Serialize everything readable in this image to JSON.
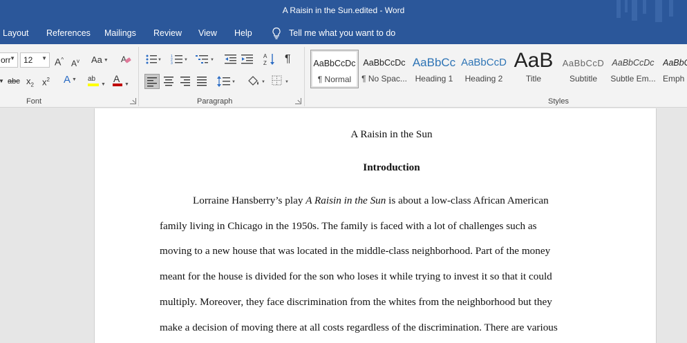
{
  "window": {
    "title": "A Raisin in the Sun.edited  -  Word"
  },
  "tabs": [
    "Layout",
    "References",
    "Mailings",
    "Review",
    "View",
    "Help"
  ],
  "tell_me": "Tell me what you want to do",
  "font_group": {
    "font_name": "orr",
    "font_size": "12",
    "label": "Font"
  },
  "paragraph_group": {
    "label": "Paragraph"
  },
  "styles_group": {
    "label": "Styles",
    "items": [
      {
        "preview": "AaBbCcDc",
        "name": "¶ Normal"
      },
      {
        "preview": "AaBbCcDc",
        "name": "¶ No Spac..."
      },
      {
        "preview": "AaBbCc",
        "name": "Heading 1"
      },
      {
        "preview": "AaBbCcD",
        "name": "Heading 2"
      },
      {
        "preview": "AaB",
        "name": "Title"
      },
      {
        "preview": "AaBbCcD",
        "name": "Subtitle"
      },
      {
        "preview": "AaBbCcDc",
        "name": "Subtle Em..."
      },
      {
        "preview": "AaBbC",
        "name": "Emph"
      }
    ]
  },
  "colors": {
    "accent": "#2b579a",
    "highlight": "#ffff00",
    "font_color": "#c00000"
  },
  "document": {
    "title": "A Raisin in the Sun",
    "heading": "Introduction",
    "p1_prefix": "Lorraine Hansberry’s play ",
    "p1_italic": "A Raisin in the Sun",
    "p1_suffix": " is about a low-class African American",
    "lines": [
      "family living in Chicago in the 1950s. The family is faced with a lot of challenges such as",
      "moving to a new house that was located in the middle-class neighborhood. Part of the money",
      "meant for the house is divided for the son who loses it while trying to invest it so that it could",
      "multiply. Moreover, they face discrimination from the whites from the neighborhood but they",
      "make a decision of moving there at all costs regardless of the discrimination. There are various"
    ]
  }
}
